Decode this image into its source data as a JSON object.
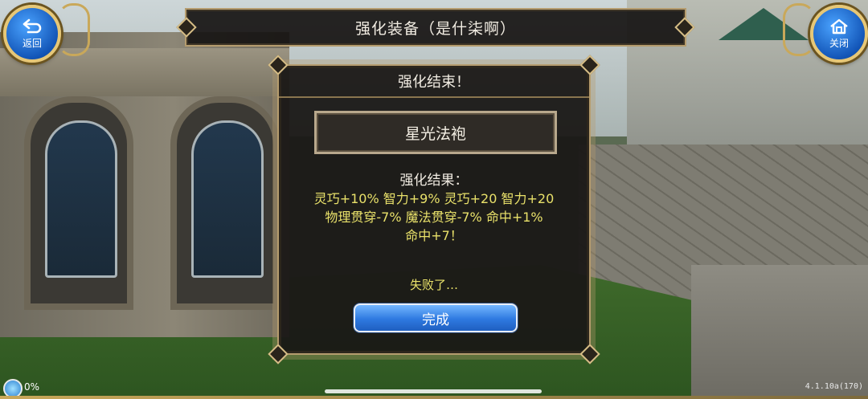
{
  "header": {
    "title": "强化装备（是什柒啊）",
    "back_label": "返回",
    "close_label": "关闭"
  },
  "dialog": {
    "title": "强化结束！",
    "item_name": "星光法袍",
    "result_heading": "强化结果：",
    "result_lines": [
      "灵巧+10% 智力+9% 灵巧+20 智力+20",
      "物理贯穿-7% 魔法贯穿-7% 命中+1%",
      "命中+7！"
    ],
    "status": "失败了…",
    "confirm_label": "完成"
  },
  "footer": {
    "exp_percent": "0%",
    "version": "4.1.10a(170)"
  },
  "colors": {
    "result_text": "#e9e16a",
    "button_blue": "#2e79e0",
    "frame_gold": "#b59c6e"
  }
}
